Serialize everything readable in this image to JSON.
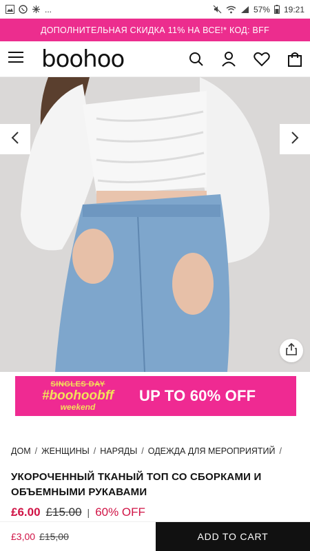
{
  "status_bar": {
    "time": "19:21",
    "battery": "57%",
    "left_extra": "..."
  },
  "promo_banner": {
    "text": "ДОПОЛНИТЕЛЬНАЯ СКИДКА 11% НА ВСЕ!* КОД: BFF"
  },
  "header": {
    "logo": "boohoo",
    "icons": [
      "menu-icon",
      "search-icon",
      "account-icon",
      "heart-icon",
      "bag-icon"
    ]
  },
  "sale_banner": {
    "top": "SINGLES DAY",
    "brand": "#boohoobff",
    "bottom": "weekend",
    "offer": "UP TO 60% OFF",
    "background": "#ef2a92",
    "accent": "#f3e05a"
  },
  "breadcrumb": [
    {
      "label": "ДОМ"
    },
    {
      "label": "ЖЕНЩИНЫ"
    },
    {
      "label": "НАРЯДЫ"
    },
    {
      "label": "ОДЕЖДА ДЛЯ МЕРОПРИЯТИЙ"
    }
  ],
  "product": {
    "title": "УКОРОЧЕННЫЙ ТКАНЫЙ ТОП СО СБОРКАМИ И ОБЪЕМНЫМИ РУКАВАМИ",
    "price_now": "£6.00",
    "price_was": "£15.00",
    "discount": "60% OFF",
    "price_color": "#d01345"
  },
  "sticky_bar": {
    "price_now": "£3,00",
    "price_was": "£15,00",
    "cta": "ADD TO CART"
  }
}
